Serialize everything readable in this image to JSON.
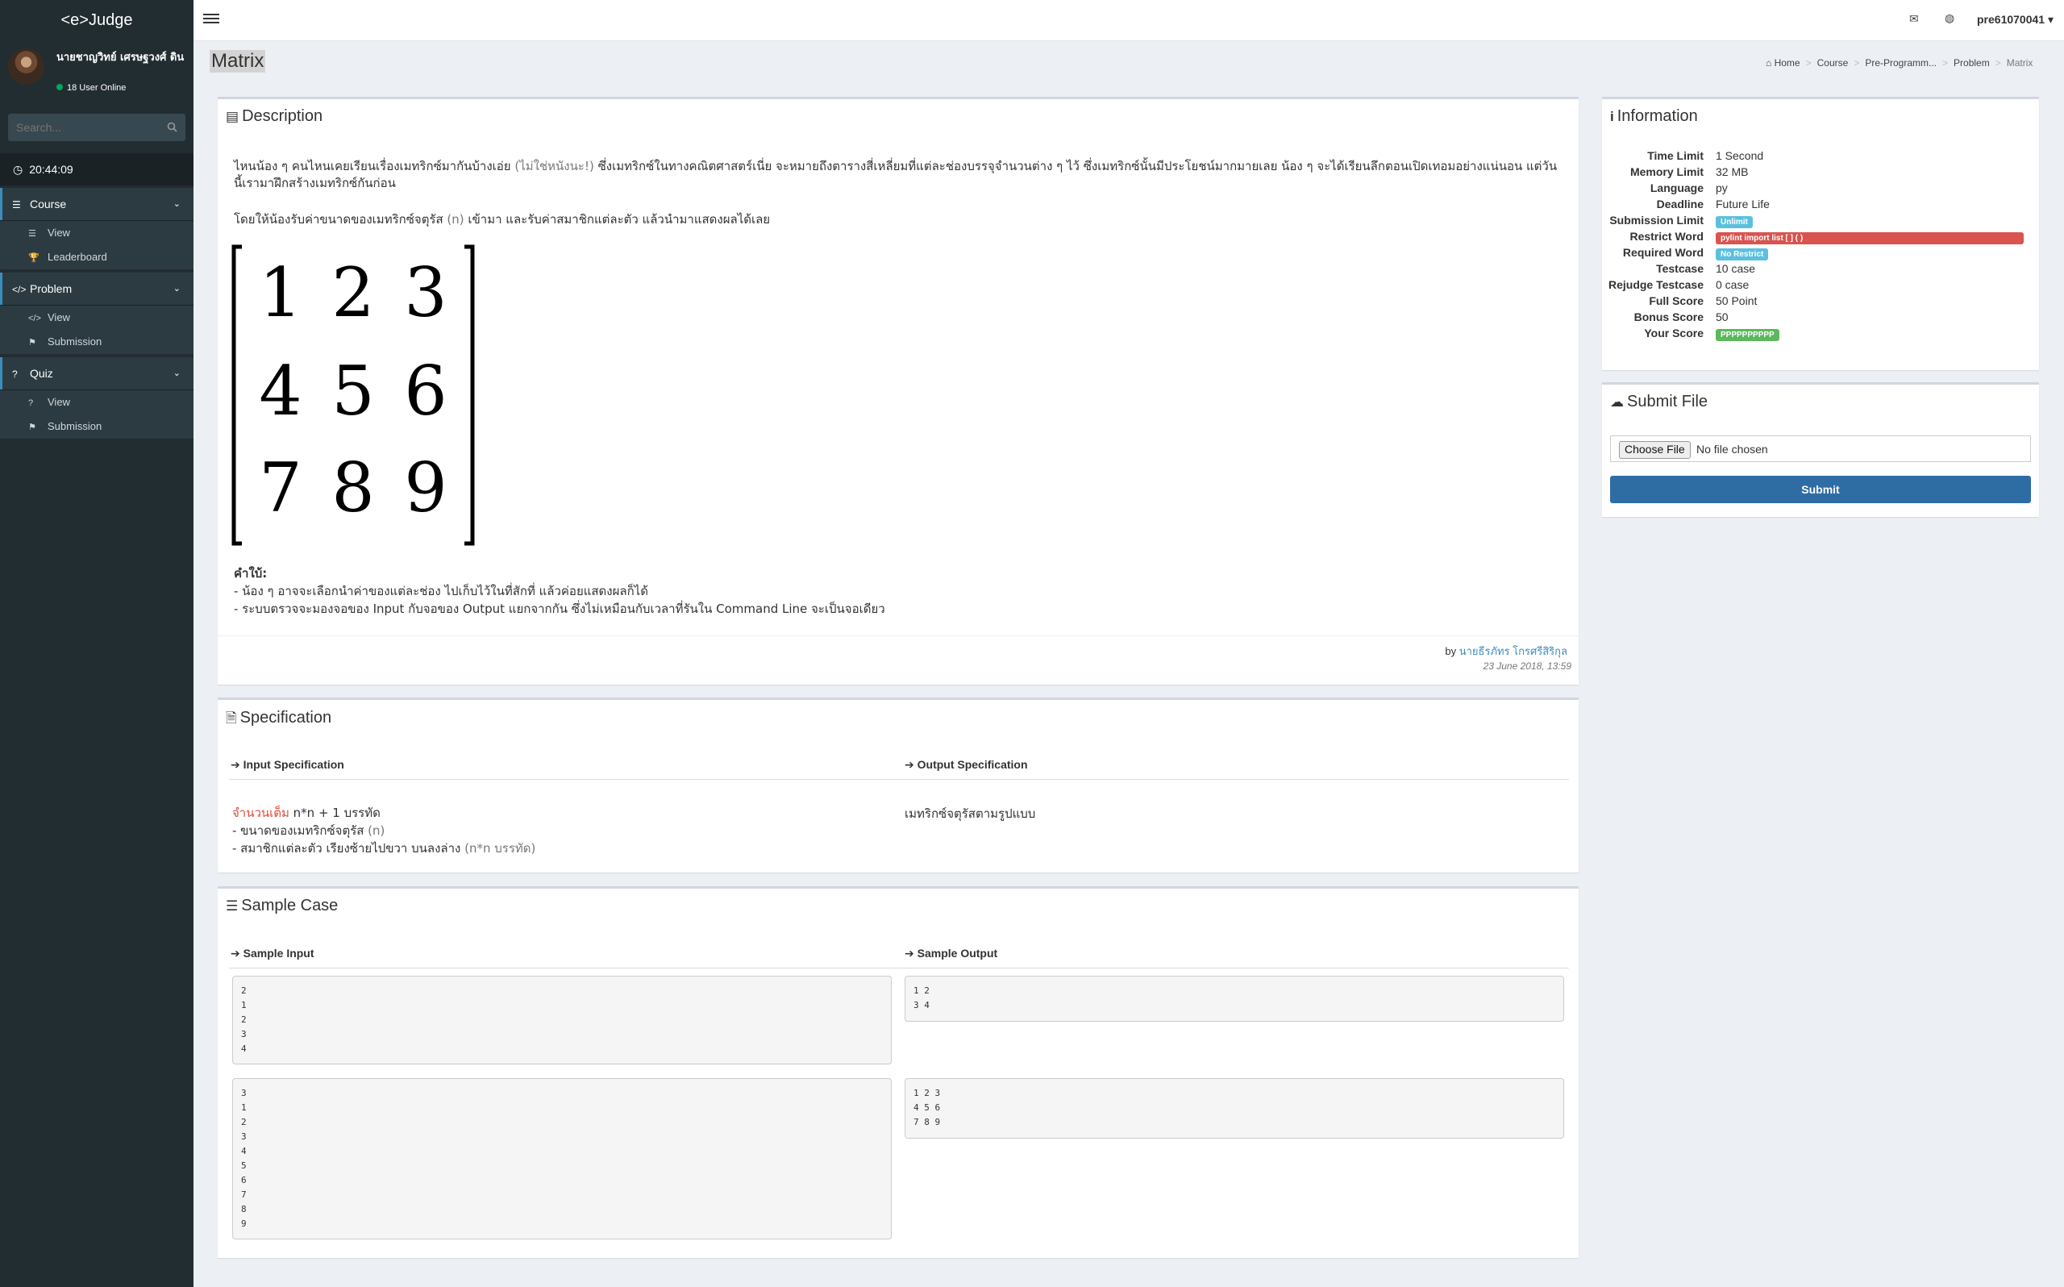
{
  "app": {
    "brand": "<e>Judge"
  },
  "sidebar": {
    "user": {
      "name": "นายชาญวิทย์ เศรษฐวงศ์ ดิน",
      "online": "18 User Online"
    },
    "search_placeholder": "Search...",
    "clock": "20:44:09",
    "menus": [
      {
        "label": "Course",
        "items": [
          "View",
          "Leaderboard"
        ]
      },
      {
        "label": "Problem",
        "items": [
          "View",
          "Submission"
        ]
      },
      {
        "label": "Quiz",
        "items": [
          "View",
          "Submission"
        ]
      }
    ]
  },
  "header": {
    "username": "pre61070041"
  },
  "page": {
    "title": "Matrix",
    "breadcrumb": [
      "Home",
      "Course",
      "Pre-Programm...",
      "Problem",
      "Matrix"
    ]
  },
  "description": {
    "title": "Description",
    "p1_a": "ไหนน้อง ๆ คนไหนเคยเรียนเรื่องเมทริกซ์มากันบ้างเอ่ย ",
    "p1_b": "(ไม่ใช่หนังนะ!)",
    "p1_c": " ซึ่งเมทริกซ์ในทางคณิตศาสตร์เนี่ย จะหมายถึงตารางสี่เหลี่ยมที่แต่ละช่องบรรจุจำนวนต่าง ๆ ไว้ ซึ่งเมทริกซ์นั้นมีประโยชน์มากมายเลย น้อง ๆ จะได้เรียนลึกตอนเปิดเทอมอย่างแน่นอน แต่วันนี้เรามาฝึกสร้างเมทริกซ์กันก่อน",
    "p2_a": "โดยให้น้องรับค่าขนาดของเมทริกซ์จตุรัส ",
    "p2_b": "(n)",
    "p2_c": " เข้ามา และรับค่าสมาชิกแต่ละตัว แล้วนำมาแสดงผลได้เลย",
    "matrix": [
      [
        "1",
        "2",
        "3"
      ],
      [
        "4",
        "5",
        "6"
      ],
      [
        "7",
        "8",
        "9"
      ]
    ],
    "hint_title": "คำใบ้:",
    "hints": [
      "- น้อง ๆ อาจจะเลือกนำค่าของแต่ละช่อง ไปเก็บไว้ในที่สักที่ แล้วค่อยแสดงผลก็ได้",
      "- ระบบตรวจจะมองจอของ Input กับจอของ Output แยกจากกัน ซึ่งไม่เหมือนกับเวลาที่รันใน Command Line จะเป็นจอเดียว"
    ],
    "by": "by",
    "author": "นายธีรภัทร โกรศรีสิริกุล",
    "date": "23 June 2018, 13:59"
  },
  "specification": {
    "title": "Specification",
    "input_title": "Input Specification",
    "output_title": "Output Specification",
    "input_line1_red": "จำนวนเต็ม",
    "input_line1_rest": " n*n + 1 บรรทัด",
    "input_line2_a": "- ขนาดของเมทริกซ์จตุรัส ",
    "input_line2_b": "(n)",
    "input_line3_a": "- สมาชิกแต่ละตัว เรียงซ้ายไปขวา บนลงล่าง ",
    "input_line3_b": "(n*n บรรทัด)",
    "output_text": "เมทริกซ์จตุรัสตามรูปแบบ"
  },
  "sample_case": {
    "title": "Sample Case",
    "input_title": "Sample Input",
    "output_title": "Sample Output",
    "cases": [
      {
        "input": "2\n1\n2\n3\n4",
        "output": "1 2\n3 4"
      },
      {
        "input": "3\n1\n2\n3\n4\n5\n6\n7\n8\n9",
        "output": "1 2 3\n4 5 6\n7 8 9"
      }
    ]
  },
  "information": {
    "title": "Information",
    "rows": [
      {
        "label": "Time Limit",
        "value": "1 Second"
      },
      {
        "label": "Memory Limit",
        "value": "32 MB"
      },
      {
        "label": "Language",
        "value": "py"
      },
      {
        "label": "Deadline",
        "value": "Future Life"
      },
      {
        "label": "Submission Limit",
        "badge": "Unlimit",
        "color": "#5bc0de"
      },
      {
        "label": "Restrict Word",
        "badge": "pylint import list [ ] ( )",
        "color": "#d9534f"
      },
      {
        "label": "Required Word",
        "badge": "No Restrict",
        "color": "#5bc0de"
      },
      {
        "label": "Testcase",
        "value": "10 case"
      },
      {
        "label": "Rejudge Testcase",
        "value": "0 case"
      },
      {
        "label": "Full Score",
        "value": "50 Point"
      },
      {
        "label": "Bonus Score",
        "value": "50"
      },
      {
        "label": "Your Score",
        "badge": "PPPPPPPPPP",
        "color": "#5cb85c"
      }
    ]
  },
  "submit": {
    "title": "Submit File",
    "choose_label": "Choose File",
    "no_file": "No file chosen",
    "submit_label": "Submit"
  }
}
